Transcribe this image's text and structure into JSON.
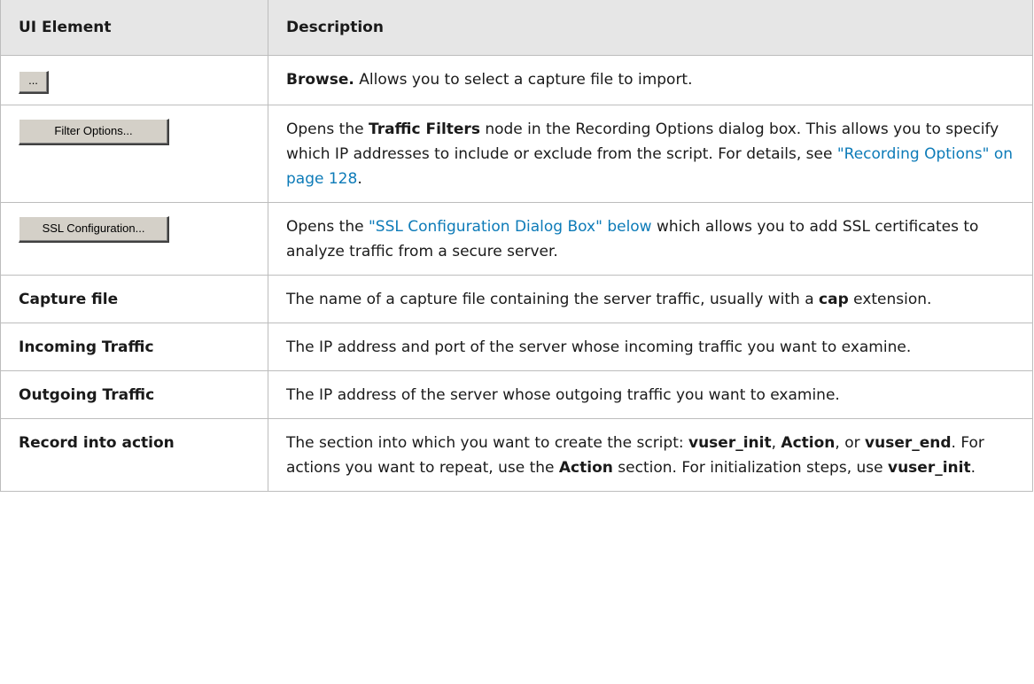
{
  "header": {
    "col1": "UI Element",
    "col2": "Description"
  },
  "rows": {
    "browse": {
      "button_label": "...",
      "desc_bold": "Browse.",
      "desc_text": " Allows you to select a capture file to import."
    },
    "filter": {
      "button_label": "Filter Options...",
      "t1": "Opens the ",
      "b1": "Traffic Filters",
      "t2": " node in the Recording Options dialog box. This allows you to specify which IP addresses to include or exclude from the script. For details, see ",
      "link": "\"Recording Options\" on page 128",
      "t3": "."
    },
    "ssl": {
      "button_label": "SSL Configuration...",
      "t1": "Opens the ",
      "link": "\"SSL Configuration Dialog Box\" below",
      "t2": " which allows you to add SSL certificates to analyze traffic from a secure server."
    },
    "capture": {
      "label": "Capture file",
      "t1": "The name of a capture file containing the server traffic, usually with a ",
      "b1": "cap",
      "t2": " extension."
    },
    "incoming": {
      "label": "Incoming Traffic",
      "text": "The IP address and port of the server whose incoming traffic you want to examine."
    },
    "outgoing": {
      "label": "Outgoing Traffic",
      "text": "The IP address of the server whose outgoing traffic you want to examine."
    },
    "record": {
      "label": "Record into action",
      "t1": "The section into which you want to create the script: ",
      "b1": "vuser_init",
      "t2": ", ",
      "b2": "Action",
      "t3": ", or ",
      "b3": "vuser_end",
      "t4": ". For actions you want to repeat, use the ",
      "b4": "Action",
      "t5": " section. For initialization steps, use ",
      "b5": "vuser_init",
      "t6": "."
    }
  }
}
